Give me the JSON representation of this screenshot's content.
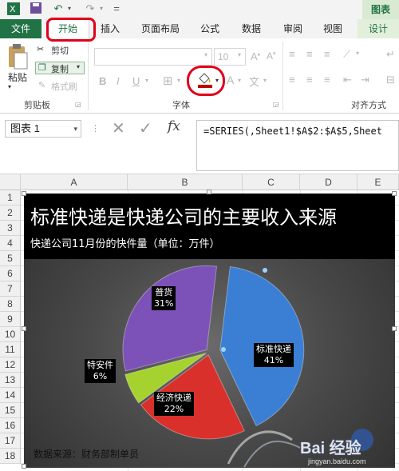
{
  "qat": {
    "undo_label": "↶",
    "redo_label": "↷",
    "customize_label": "="
  },
  "chart_tools_tab": "图表",
  "tabs": [
    {
      "label": "文件"
    },
    {
      "label": "开始"
    },
    {
      "label": "插入"
    },
    {
      "label": "页面布局"
    },
    {
      "label": "公式"
    },
    {
      "label": "数据"
    },
    {
      "label": "审阅"
    },
    {
      "label": "视图"
    },
    {
      "label": "设计"
    }
  ],
  "ribbon": {
    "paste": "粘贴",
    "cut": "剪切",
    "copy": "复制",
    "format_painter": "格式刷",
    "clipboard_group": "剪贴板",
    "font_size": "10",
    "font_group": "字体",
    "align_group": "对齐方式",
    "bold": "B",
    "italic": "I",
    "underline": "U"
  },
  "formula_bar": {
    "name_box": "图表 1",
    "fx": "fx",
    "formula": "=SERIES(,Sheet1!$A$2:$A$5,Sheet"
  },
  "columns": [
    "A",
    "B",
    "C",
    "D",
    "E"
  ],
  "rows": [
    "1",
    "2",
    "3",
    "4",
    "5",
    "6",
    "7",
    "8",
    "9",
    "10",
    "11",
    "12",
    "13",
    "14",
    "15",
    "16",
    "17",
    "18"
  ],
  "chart_data": {
    "type": "pie",
    "title": "标准快递是快递公司的主要收入来源",
    "subtitle": "快递公司11月份的快件量（单位：万件）",
    "source": "数据来源：财务部制单员",
    "slices": [
      {
        "name": "标准快递",
        "percent": 41,
        "label": "41%",
        "color": "#3b7fd4"
      },
      {
        "name": "经济快递",
        "percent": 22,
        "label": "22%",
        "color": "#d9302c"
      },
      {
        "name": "特安件",
        "percent": 6,
        "label": "6%",
        "color": "#a6d230"
      },
      {
        "name": "普货",
        "percent": 31,
        "label": "31%",
        "color": "#7c52b8"
      }
    ]
  },
  "watermark": {
    "text": "Bai 经验",
    "url": "jingyan.baidu.com"
  }
}
